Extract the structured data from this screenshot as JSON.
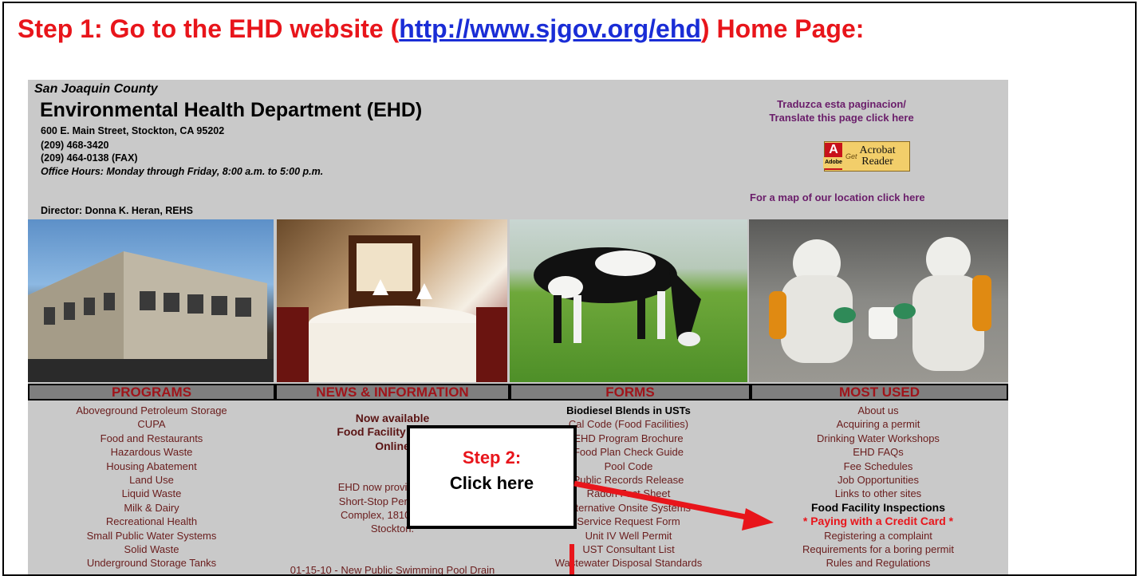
{
  "heading": {
    "before": "Step 1: Go to the EHD website (",
    "link": "http://www.sjgov.org/ehd",
    "after": ") Home Page:"
  },
  "site": {
    "county": "San Joaquin County",
    "department": "Environmental Health Department (EHD)",
    "address": "600 E. Main Street, Stockton, CA 95202",
    "phone": "(209) 468-3420",
    "fax": "(209) 464-0138 (FAX)",
    "hours": "Office Hours: Monday through Friday, 8:00 a.m. to 5:00 p.m.",
    "director": "Director: Donna K. Heran, REHS",
    "translate_line1": "Traduzca esta paginacion/",
    "translate_line2": "Translate this page click here",
    "acrobat": {
      "logo": "A",
      "adobe": "Adobe",
      "get": "Get",
      "line1": "Acrobat",
      "line2": "Reader"
    },
    "map_link": "For a map of our location click here"
  },
  "nav": [
    "PROGRAMS",
    "NEWS & INFORMATION",
    "FORMS",
    "MOST USED"
  ],
  "programs": [
    "Aboveground Petroleum Storage",
    "CUPA",
    "Food and Restaurants",
    "Hazardous Waste",
    "Housing Abatement",
    "Land Use",
    "Liquid Waste",
    "Milk & Dairy",
    "Recreational Health",
    "Small Public Water Systems",
    "Solid Waste",
    "Underground Storage Tanks"
  ],
  "news": {
    "now_available": "Now available",
    "food_facility": "Food Facility Inspect",
    "online": "Online",
    "para_l1": "EHD now provides cour",
    "para_l2": "Short-Stop Permit Cent",
    "para_l3": "Complex, 1810 E. Haz",
    "para_l4": "Stockton.",
    "item": "01-15-10 - New Public Swimming Pool Drain"
  },
  "forms": [
    "Biodiesel Blends in USTs",
    "Cal Code (Food Facilities)",
    "EHD Program Brochure",
    "Food Plan Check Guide",
    "Pool Code",
    "Public Records Release",
    "Radon Fact Sheet",
    "Alternative Onsite Systems",
    "Service Request Form",
    "Unit IV Well Permit",
    "UST Consultant List",
    "Wastewater Disposal Standards"
  ],
  "most_used": [
    "About us",
    "Acquiring a permit",
    "Drinking Water Workshops",
    "EHD FAQs",
    "Fee Schedules",
    "Job Opportunities",
    "Links to other sites",
    "Food Facility Inspections",
    "* Paying with a Credit Card *",
    "Registering a complaint",
    "Requirements for a boring permit",
    "Rules and Regulations"
  ],
  "callout": {
    "step": "Step 2:",
    "action": "Click here"
  },
  "colors": {
    "heading_red": "#e8151b",
    "link_blue": "#1a2dd6",
    "panel_gray": "#c9c9c9",
    "nav_text": "#a0141a",
    "nav_bg": "#7f7f7f"
  }
}
